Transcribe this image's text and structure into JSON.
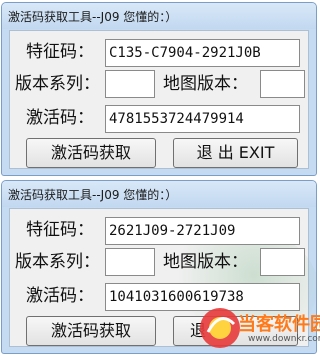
{
  "windows": [
    {
      "title": "激活码获取工具--J09 您懂的：）",
      "labels": {
        "feature_code": "特征码：",
        "version_series": "版本系列：",
        "map_version": "地图版本：",
        "activation_code": "激活码："
      },
      "fields": {
        "feature_code": "C135-C7904-2921J0B",
        "version_series": "",
        "map_version": "",
        "activation_code": "4781553724479914"
      },
      "buttons": {
        "get_activation": "激活码获取",
        "exit": "退  出 EXIT"
      }
    },
    {
      "title": "激活码获取工具--J09 您懂的：）",
      "labels": {
        "feature_code": "特征码：",
        "version_series": "版本系列：",
        "map_version": "地图版本：",
        "activation_code": "激活码："
      },
      "fields": {
        "feature_code": "2621J09-2721J09",
        "version_series": "",
        "map_version": "",
        "activation_code": "1041031600619738"
      },
      "buttons": {
        "get_activation": "激活码获取",
        "exit": "退"
      }
    }
  ],
  "watermark": {
    "name": "当客软件园",
    "url": "www.downkr.com",
    "accent": "#ff7a1a"
  }
}
